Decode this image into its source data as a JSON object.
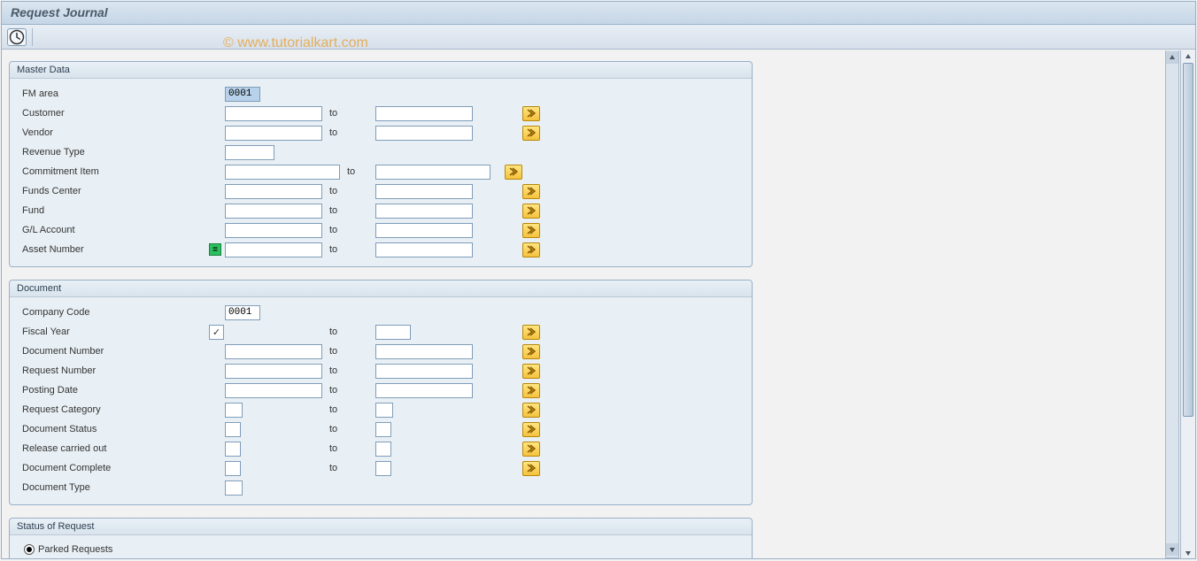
{
  "title": "Request Journal",
  "watermark": "© www.tutorialkart.com",
  "labels": {
    "to": "to"
  },
  "master": {
    "title": "Master Data",
    "fm_area_label": "FM area",
    "fm_area_value": "0001",
    "customer_label": "Customer",
    "customer_from": "",
    "customer_to": "",
    "vendor_label": "Vendor",
    "vendor_from": "",
    "vendor_to": "",
    "revenue_type_label": "Revenue Type",
    "revenue_type": "",
    "commitment_item_label": "Commitment Item",
    "commitment_item_from": "",
    "commitment_item_to": "",
    "funds_center_label": "Funds Center",
    "funds_center_from": "",
    "funds_center_to": "",
    "fund_label": "Fund",
    "fund_from": "",
    "fund_to": "",
    "gl_account_label": "G/L Account",
    "gl_account_from": "",
    "gl_account_to": "",
    "asset_number_label": "Asset Number",
    "asset_number_from": "",
    "asset_number_to": ""
  },
  "document": {
    "title": "Document",
    "company_code_label": "Company Code",
    "company_code": "0001",
    "fiscal_year_label": "Fiscal Year",
    "fiscal_year_from": "",
    "fiscal_year_to": "",
    "fiscal_year_checked": true,
    "doc_number_label": "Document Number",
    "doc_number_from": "",
    "doc_number_to": "",
    "req_number_label": "Request Number",
    "req_number_from": "",
    "req_number_to": "",
    "posting_date_label": "Posting Date",
    "posting_date_from": "",
    "posting_date_to": "",
    "req_category_label": "Request Category",
    "req_category_from": "",
    "req_category_to": "",
    "doc_status_label": "Document Status",
    "doc_status_from": "",
    "doc_status_to": "",
    "release_label": "Release carried out",
    "release_from": "",
    "release_to": "",
    "doc_complete_label": "Document Complete",
    "doc_complete_from": "",
    "doc_complete_to": "",
    "doc_type_label": "Document Type",
    "doc_type": ""
  },
  "status": {
    "title": "Status of Request",
    "parked_label": "Parked Requests"
  }
}
